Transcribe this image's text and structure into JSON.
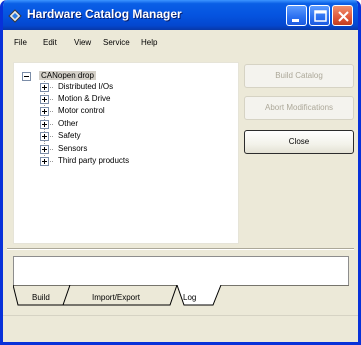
{
  "window": {
    "title": "Hardware Catalog Manager"
  },
  "titlebar_buttons": {
    "minimize": "minimize",
    "maximize": "maximize",
    "close": "close"
  },
  "menu": {
    "items": [
      "File",
      "Edit",
      "View",
      "Service",
      "Help"
    ]
  },
  "tree": {
    "root_label": "CANopen drop",
    "children": [
      "Distributed I/Os",
      "Motion & Drive",
      "Motor control",
      "Other",
      "Safety",
      "Sensors",
      "Third party products"
    ]
  },
  "actions": {
    "build_catalog": "Build Catalog",
    "abort_modifications": "Abort Modifications",
    "close": "Close"
  },
  "tabs": {
    "items": [
      "Build",
      "Import/Export",
      "Log"
    ],
    "active": "Log"
  },
  "colors": {
    "titlebar": "#0554e0",
    "window_bg": "#ece9d8",
    "close_button": "#e0583a"
  }
}
